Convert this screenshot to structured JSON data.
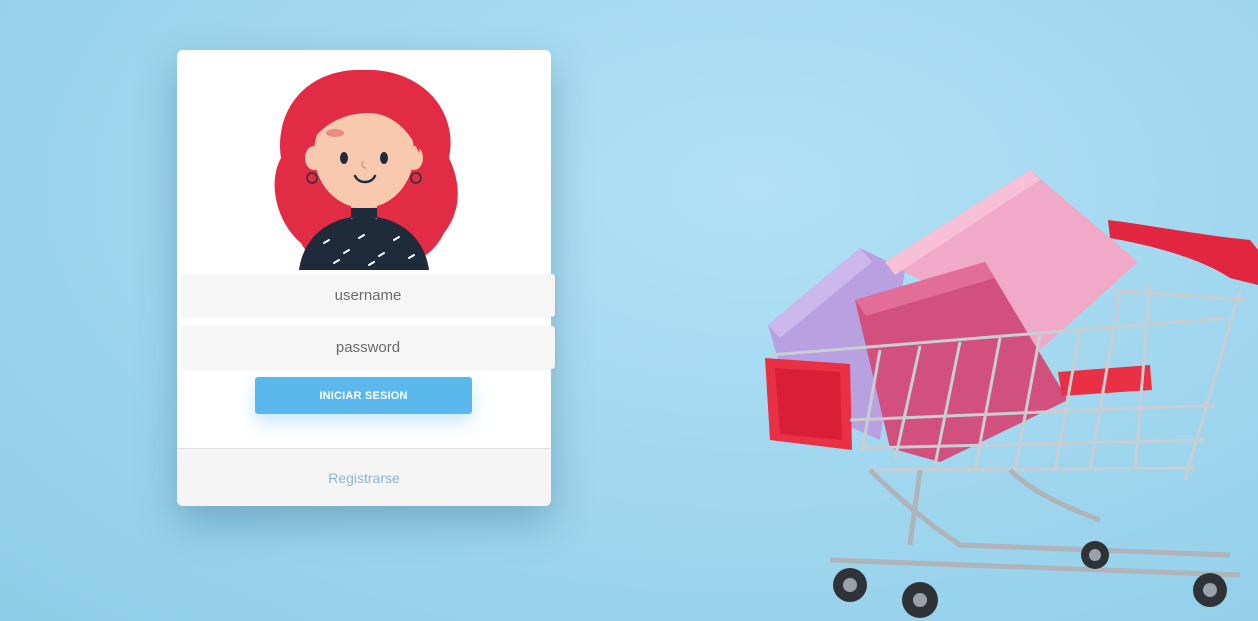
{
  "login": {
    "username_placeholder": "username",
    "password_placeholder": "password",
    "submit_label": "INICIAR SESION",
    "register_label": "Registrarse"
  },
  "colors": {
    "background": "#a2d8ef",
    "button": "#5bb8ec",
    "hair": "#e22c45",
    "link": "#8fb3d3"
  },
  "icons": {
    "avatar": "woman-avatar-icon",
    "background": "shopping-cart-with-gift-boxes"
  }
}
